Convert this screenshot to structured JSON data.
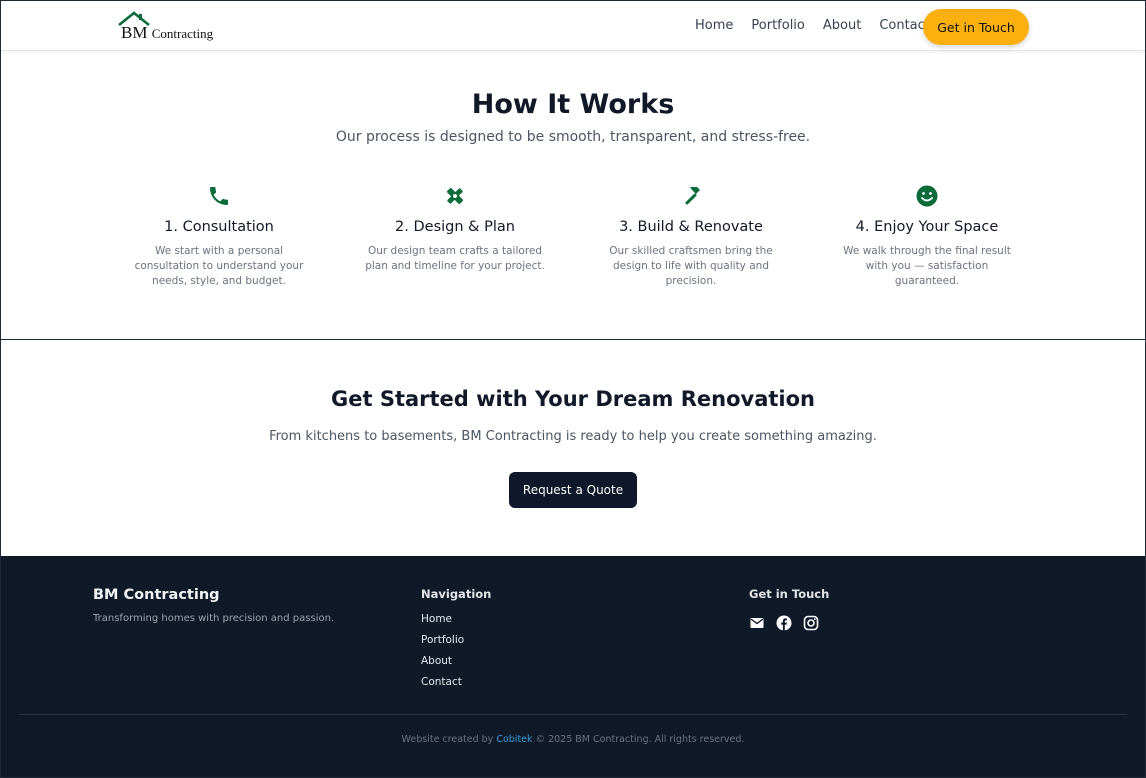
{
  "colors": {
    "accent": "#fbb00f",
    "icon_green": "#0b6b3a",
    "dark": "#0f172a",
    "footer_bg": "#0f1927",
    "link_blue": "#3b9dd8"
  },
  "header": {
    "logo_main": "BM",
    "logo_small": "Contracting",
    "logo_icon": "house-icon",
    "nav": [
      {
        "label": "Home"
      },
      {
        "label": "Portfolio"
      },
      {
        "label": "About"
      },
      {
        "label": "Contact"
      }
    ],
    "cta_label": "Get in Touch"
  },
  "how": {
    "title": "How It Works",
    "subtitle": "Our process is designed to be smooth, transparent, and stress-free.",
    "steps": [
      {
        "icon": "phone-icon",
        "title": "1. Consultation",
        "text": "We start with a personal consultation to understand your needs, style, and budget."
      },
      {
        "icon": "design-tools-icon",
        "title": "2. Design & Plan",
        "text": "Our design team crafts a tailored plan and timeline for your project."
      },
      {
        "icon": "hammer-icon",
        "title": "3. Build & Renovate",
        "text": "Our skilled craftsmen bring the design to life with quality and precision."
      },
      {
        "icon": "smiley-icon",
        "title": "4. Enjoy Your Space",
        "text": "We walk through the final result with you — satisfaction guaranteed."
      }
    ]
  },
  "getstarted": {
    "title": "Get Started with Your Dream Renovation",
    "subtitle": "From kitchens to basements, BM Contracting is ready to help you create something amazing.",
    "button": "Request a Quote"
  },
  "footer": {
    "brand": "BM Contracting",
    "tagline": "Transforming homes with precision and passion.",
    "nav_heading": "Navigation",
    "nav": [
      "Home",
      "Portfolio",
      "About",
      "Contact"
    ],
    "contact_heading": "Get in Touch",
    "social": [
      "email-icon",
      "facebook-icon",
      "instagram-icon"
    ],
    "copy_prefix": "Website created by",
    "copy_link": "Cobitek",
    "copy_suffix": "© 2025 BM Contracting. All rights reserved."
  }
}
